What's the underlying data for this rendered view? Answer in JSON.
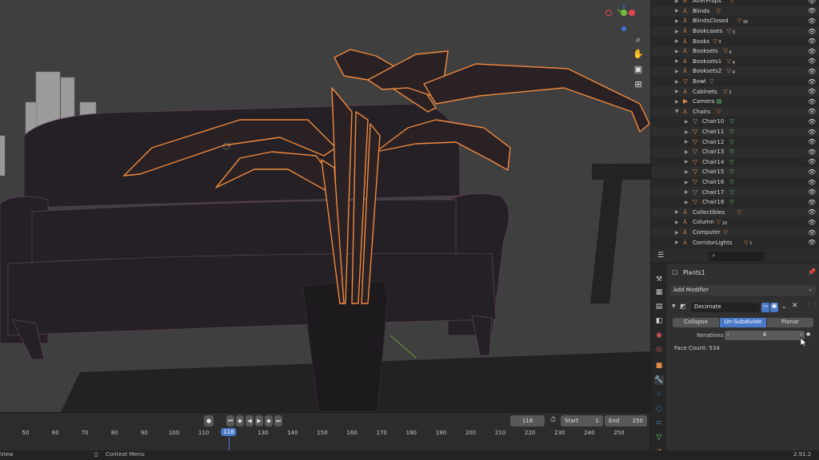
{
  "viewport": {
    "gizmo_x_color": "#e2454f",
    "gizmo_y_color": "#6fbf39",
    "gizmo_z_color": "#3f77d6",
    "selection_color": "#f0893c",
    "edge_color": "#c53fb8"
  },
  "outliner": {
    "items": [
      {
        "label": "AlterProps",
        "type": "empty",
        "indent": 0
      },
      {
        "label": "Blinds",
        "type": "empty",
        "indent": 0
      },
      {
        "label": "BlindsClosed",
        "type": "empty",
        "indent": 0,
        "badge": "36"
      },
      {
        "label": "Bookcases",
        "type": "empty",
        "indent": 0,
        "badge": "3"
      },
      {
        "label": "Books",
        "type": "empty",
        "indent": 0,
        "badge": "3"
      },
      {
        "label": "Booksets",
        "type": "empty",
        "indent": 0,
        "badge": "4"
      },
      {
        "label": "Booksets1",
        "type": "empty",
        "indent": 0,
        "badge": "4"
      },
      {
        "label": "Booksets2",
        "type": "empty",
        "indent": 0,
        "badge": "4"
      },
      {
        "label": "Bowl",
        "type": "mesh",
        "indent": 0
      },
      {
        "label": "Cabinets",
        "type": "empty",
        "indent": 0,
        "badge": "2"
      },
      {
        "label": "Camera",
        "type": "camera",
        "indent": 0
      },
      {
        "label": "Chairs",
        "type": "empty",
        "indent": 0,
        "expanded": true
      },
      {
        "label": "Chair10",
        "type": "mesh",
        "indent": 1
      },
      {
        "label": "Chair11",
        "type": "mesh",
        "indent": 1
      },
      {
        "label": "Chair12",
        "type": "mesh",
        "indent": 1
      },
      {
        "label": "Chair13",
        "type": "mesh",
        "indent": 1
      },
      {
        "label": "Chair14",
        "type": "mesh",
        "indent": 1
      },
      {
        "label": "Chair15",
        "type": "mesh",
        "indent": 1
      },
      {
        "label": "Chair16",
        "type": "mesh",
        "indent": 1
      },
      {
        "label": "Chair17",
        "type": "mesh",
        "indent": 1
      },
      {
        "label": "Chair18",
        "type": "mesh",
        "indent": 1
      },
      {
        "label": "Collectibles",
        "type": "empty",
        "indent": 0
      },
      {
        "label": "Column",
        "type": "empty",
        "indent": 0,
        "badge": "16"
      },
      {
        "label": "Computer",
        "type": "empty",
        "indent": 0
      },
      {
        "label": "CorridorLights",
        "type": "empty",
        "indent": 0,
        "badge": "1"
      }
    ]
  },
  "properties": {
    "search_placeholder": "",
    "object_name": "Plants1",
    "add_modifier_label": "Add Modifier",
    "modifier_name": "Decimate",
    "mode_tabs": [
      "Collapse",
      "Un-Subdivide",
      "Planar"
    ],
    "active_mode": "Un-Subdivide",
    "iterations_label": "Iterations",
    "iterations_value": "4",
    "face_count_text": "Face Count: 534"
  },
  "timeline": {
    "current_frame": "118",
    "start_label": "Start",
    "start_value": "1",
    "end_label": "End",
    "end_value": "250",
    "ticks": [
      "50",
      "60",
      "70",
      "80",
      "90",
      "100",
      "110",
      "118",
      "130",
      "140",
      "150",
      "160",
      "170",
      "180",
      "190",
      "200",
      "210",
      "220",
      "230",
      "240",
      "250"
    ]
  },
  "statusbar": {
    "left_text": "View",
    "context_menu": "Context Menu",
    "version": "2.91.2"
  }
}
